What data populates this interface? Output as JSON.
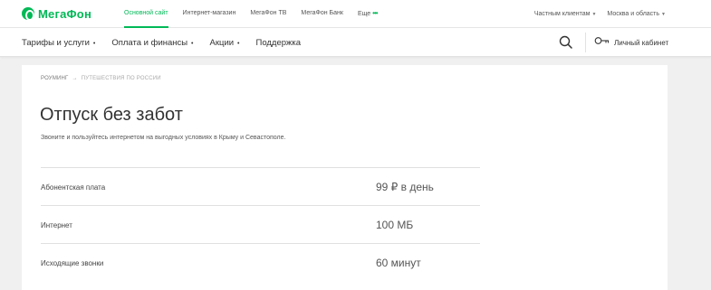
{
  "header": {
    "logo_text": "МегаФон",
    "top_links": [
      {
        "label": "Основной сайт",
        "active": true
      },
      {
        "label": "Интернет-магазин",
        "active": false
      },
      {
        "label": "МегаФон ТВ",
        "active": false
      },
      {
        "label": "МегаФон Банк",
        "active": false
      }
    ],
    "more_label": "Еще",
    "more_dots": "•••",
    "segment_label": "Частным клиентам",
    "region_label": "Москва и область",
    "brand_color": "#00b956"
  },
  "nav": {
    "items": [
      {
        "label": "Тарифы и услуги",
        "has_dropdown": true
      },
      {
        "label": "Оплата и финансы",
        "has_dropdown": true
      },
      {
        "label": "Акции",
        "has_dropdown": true
      },
      {
        "label": "Поддержка",
        "has_dropdown": false
      }
    ],
    "search_icon": "search-icon",
    "cabinet_label": "Личный кабинет",
    "cabinet_icon": "key-icon"
  },
  "page": {
    "breadcrumb": {
      "parent": "Роуминг",
      "separator": "→",
      "current": "Путешествия по России"
    },
    "title": "Отпуск без забот",
    "subtitle": "Звоните и пользуйтесь интернетом на выгодных условиях в Крыму и Севастополе.",
    "rows": [
      {
        "label": "Абонентская плата",
        "value": "99 ₽ в день"
      },
      {
        "label": "Интернет",
        "value": "100 МБ"
      },
      {
        "label": "Исходящие звонки",
        "value": "60 минут"
      }
    ]
  }
}
